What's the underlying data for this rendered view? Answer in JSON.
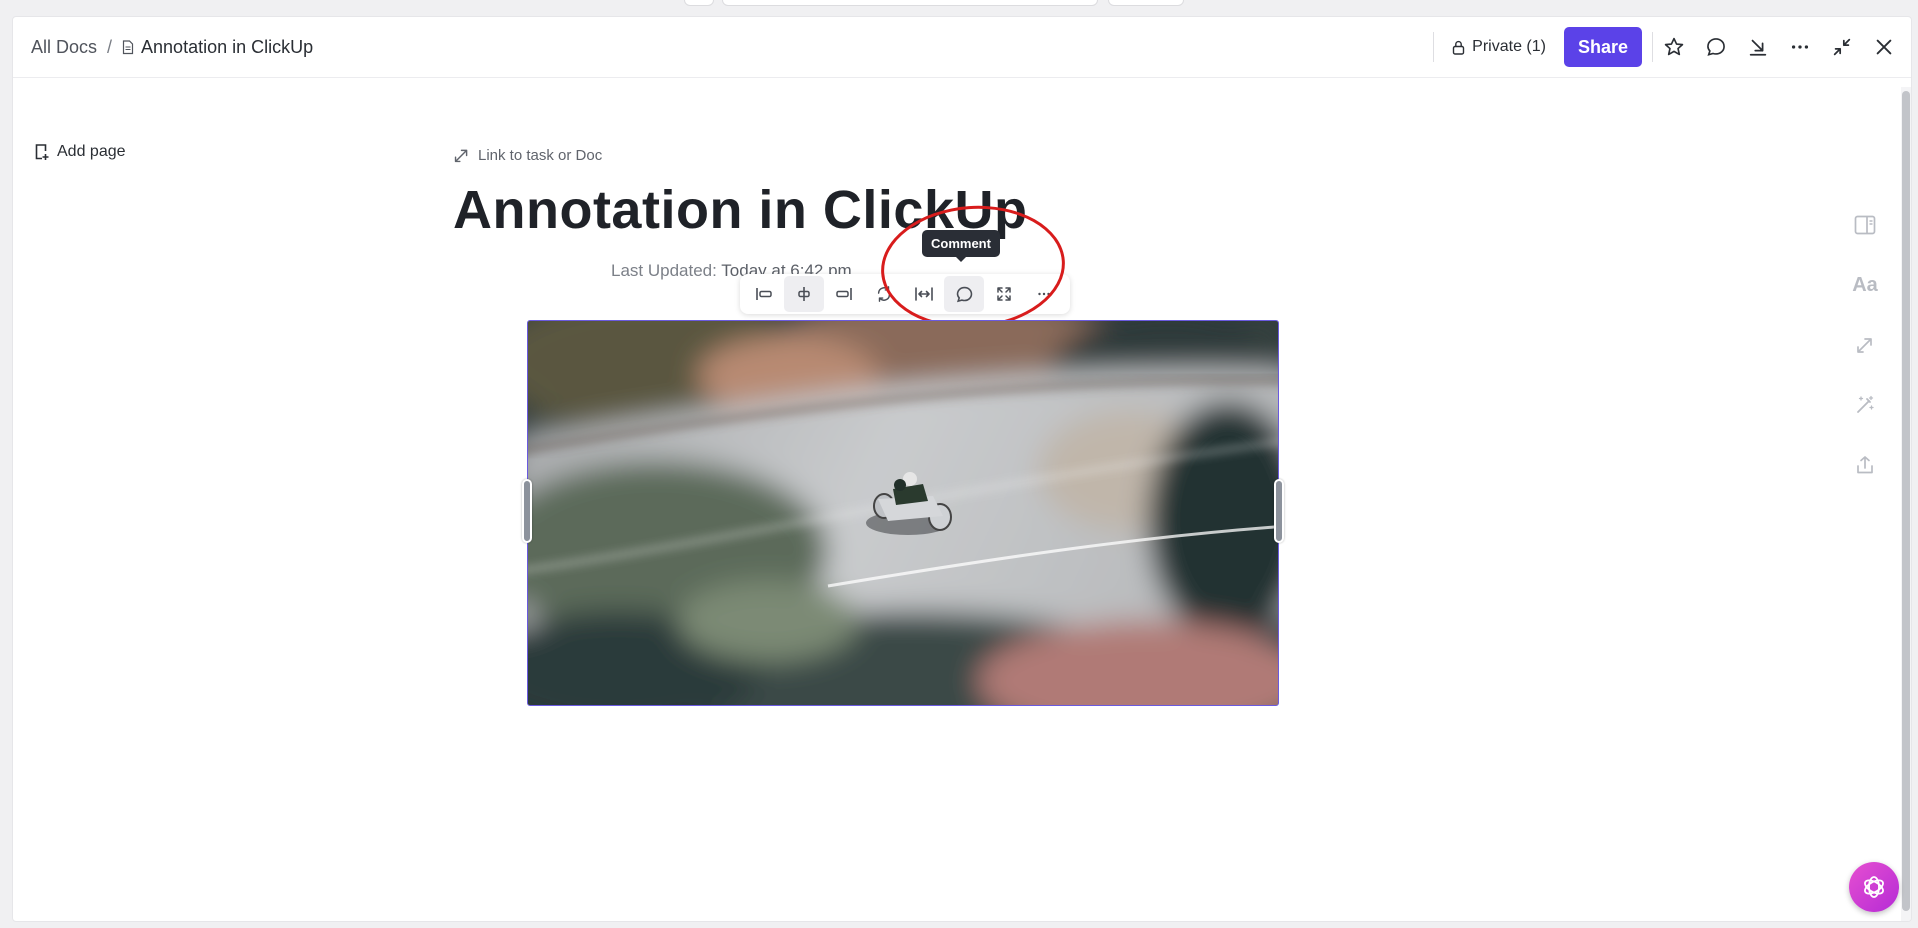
{
  "breadcrumb": {
    "root": "All Docs",
    "separator": "/",
    "current": "Annotation in ClickUp"
  },
  "header": {
    "privacy_label": "Private (1)",
    "share_label": "Share"
  },
  "sidebar": {
    "add_page_label": "Add page"
  },
  "doc": {
    "link_label": "Link to task or Doc",
    "title": "Annotation in ClickUp",
    "updated_prefix": "Last Updated:",
    "updated_value": "Today at 6:42 pm"
  },
  "image_toolbar": {
    "tooltip": "Comment",
    "active_button": "comment"
  },
  "right_rail": {
    "font_label": "Aa"
  },
  "colors": {
    "accent": "#5b42e8",
    "selection": "#6a5ae0",
    "annotation": "#d81c1c",
    "fab": "#d13ed4"
  },
  "icons": [
    "doc-icon",
    "lock-icon",
    "star-icon",
    "comment-icon",
    "download-icon",
    "more-icon",
    "minimize-icon",
    "close-icon",
    "add-page-icon",
    "link-icon",
    "align-left-icon",
    "align-center-icon",
    "align-right-icon",
    "replace-icon",
    "fit-width-icon",
    "fullscreen-icon",
    "sidebar-panel-icon",
    "relate-icon",
    "ai-wand-icon",
    "export-icon",
    "ai-assistant-icon"
  ]
}
